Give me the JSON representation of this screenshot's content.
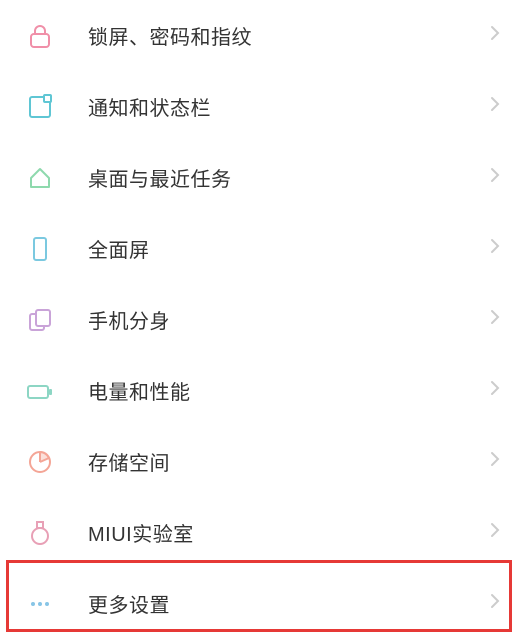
{
  "settings": {
    "items": [
      {
        "id": "lock",
        "label": "锁屏、密码和指纹",
        "icon": "lock-icon",
        "color": "#f08fa8"
      },
      {
        "id": "notification",
        "label": "通知和状态栏",
        "icon": "notification-icon",
        "color": "#5fc6d4"
      },
      {
        "id": "home",
        "label": "桌面与最近任务",
        "icon": "home-icon",
        "color": "#8ed9ad"
      },
      {
        "id": "fullscreen",
        "label": "全面屏",
        "icon": "fullscreen-icon",
        "color": "#7bc9e0"
      },
      {
        "id": "secondspace",
        "label": "手机分身",
        "icon": "secondspace-icon",
        "color": "#c9a3d8"
      },
      {
        "id": "battery",
        "label": "电量和性能",
        "icon": "battery-icon",
        "color": "#8dd6c4"
      },
      {
        "id": "storage",
        "label": "存储空间",
        "icon": "storage-icon",
        "color": "#f4a596"
      },
      {
        "id": "lab",
        "label": "MIUI实验室",
        "icon": "lab-icon",
        "color": "#e8a0b6"
      },
      {
        "id": "more",
        "label": "更多设置",
        "icon": "more-icon",
        "color": "#88c5e6"
      }
    ]
  }
}
